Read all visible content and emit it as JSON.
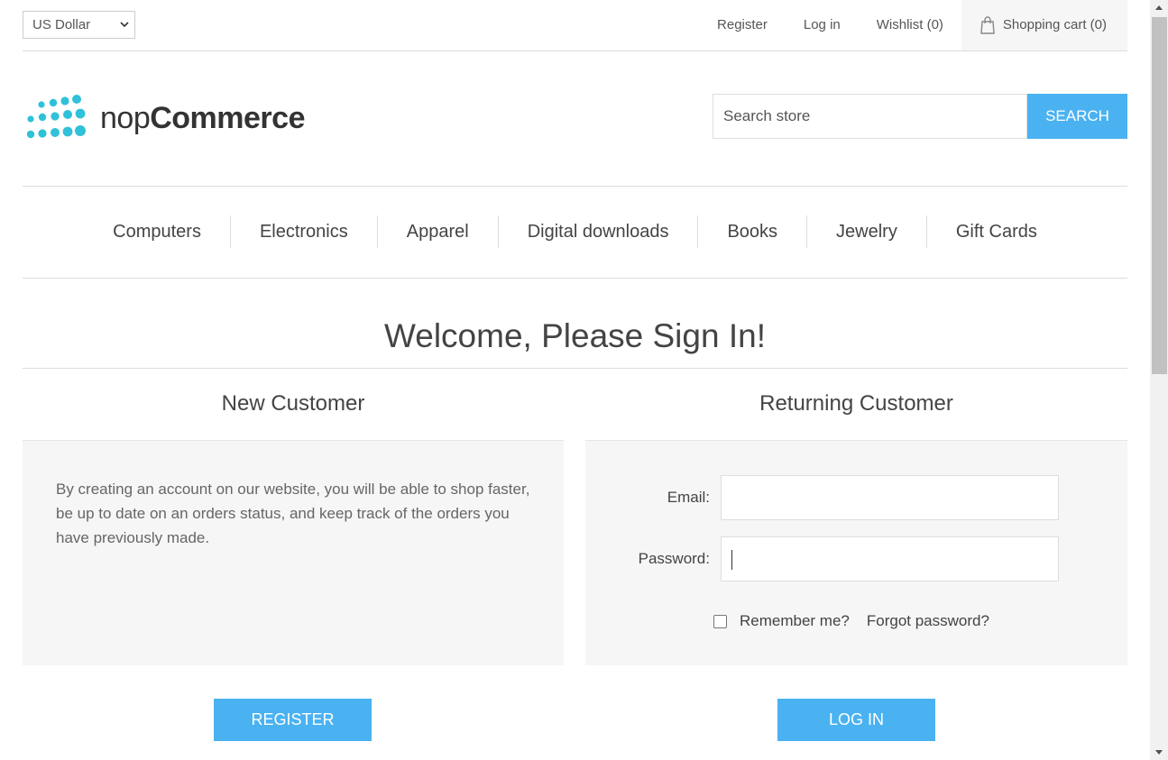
{
  "header": {
    "currency": "US Dollar",
    "links": {
      "register": "Register",
      "login": "Log in",
      "wishlist": "Wishlist (0)",
      "cart": "Shopping cart (0)"
    }
  },
  "logo": {
    "light": "nop",
    "bold": "Commerce",
    "dot_color": "#2fc1d9"
  },
  "search": {
    "placeholder": "Search store",
    "button": "SEARCH"
  },
  "nav": [
    "Computers",
    "Electronics",
    "Apparel",
    "Digital downloads",
    "Books",
    "Jewelry",
    "Gift Cards"
  ],
  "page_title": "Welcome, Please Sign In!",
  "new_customer": {
    "title": "New Customer",
    "text": "By creating an account on our website, you will be able to shop faster, be up to date on an orders status, and keep track of the orders you have previously made.",
    "button": "REGISTER"
  },
  "returning_customer": {
    "title": "Returning Customer",
    "email_label": "Email:",
    "email_value": "",
    "password_label": "Password:",
    "password_value": "",
    "remember": "Remember me?",
    "forgot": "Forgot password?",
    "button": "LOG IN"
  },
  "colors": {
    "accent": "#4ab2f1",
    "panel": "#f6f6f6"
  }
}
